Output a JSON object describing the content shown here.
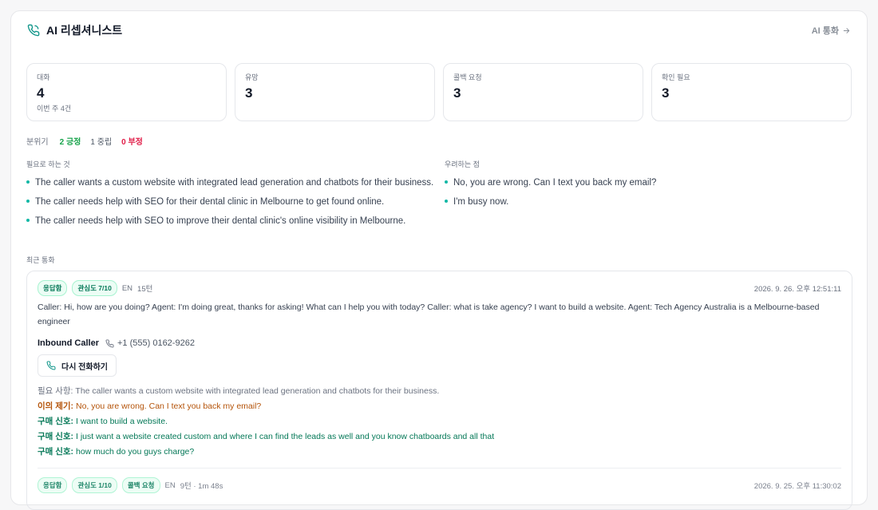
{
  "header": {
    "title": "AI 리셉셔니스트",
    "link_label": "AI 통화",
    "icons": {
      "phone": "phone-icon",
      "arrow": "arrow-right-icon"
    }
  },
  "stats": [
    {
      "label": "대화",
      "value": "4",
      "sub": "이번 주 4건"
    },
    {
      "label": "유망",
      "value": "3",
      "sub": ""
    },
    {
      "label": "콜백 요청",
      "value": "3",
      "sub": ""
    },
    {
      "label": "확인 필요",
      "value": "3",
      "sub": ""
    }
  ],
  "mood": {
    "label": "분위기",
    "positive": "2 긍정",
    "neutral": "1 중립",
    "negative": "0 부정"
  },
  "needs": {
    "title": "필요로 하는 것",
    "items": [
      "The caller wants a custom website with integrated lead generation and chatbots for their business.",
      "The caller needs help with SEO for their dental clinic in Melbourne to get found online.",
      "The caller needs help with SEO to improve their dental clinic's online visibility in Melbourne."
    ]
  },
  "concerns": {
    "title": "우려하는 점",
    "items": [
      "No, you are wrong. Can I text you back my email?",
      "I'm busy now."
    ]
  },
  "recent": {
    "label": "최근 통화",
    "calls": [
      {
        "badges": [
          "응답함",
          "관심도 7/10"
        ],
        "lang": "EN",
        "duration": "15턴",
        "time": "2026. 9. 26. 오후 12:51:11",
        "transcript": "Caller: Hi, how are you doing? Agent: I'm doing great, thanks for asking! What can I help you with today? Caller: what is take agency? I want to build a website. Agent: Tech Agency Australia is a Melbourne-based engineer",
        "caller_name": "Inbound Caller",
        "caller_number": "+1 (555) 0162-9262",
        "callback_label": "다시 전화하기",
        "need": {
          "key": "필요 사항:",
          "text": "The caller wants a custom website with integrated lead generation and chatbots for their business."
        },
        "objection": {
          "key": "이의 제기:",
          "text": "No, you are wrong. Can I text you back my email?"
        },
        "signals": [
          {
            "key": "구매 신호:",
            "text": "I want to build a website."
          },
          {
            "key": "구매 신호:",
            "text": "I just want a website created custom and where I can find the leads as well and you know chatboards and all that"
          },
          {
            "key": "구매 신호:",
            "text": "how much do you guys charge?"
          }
        ]
      },
      {
        "badges": [
          "응답함",
          "관심도 1/10",
          "콜백 요청"
        ],
        "lang": "EN",
        "duration": "9턴 · 1m 48s",
        "time": "2026. 9. 25. 오후 11:30:02"
      }
    ]
  },
  "colors": {
    "accent": "#14b8a6",
    "positive": "#16a34a",
    "negative": "#e11d48",
    "objection": "#b45309",
    "signal": "#047857"
  }
}
